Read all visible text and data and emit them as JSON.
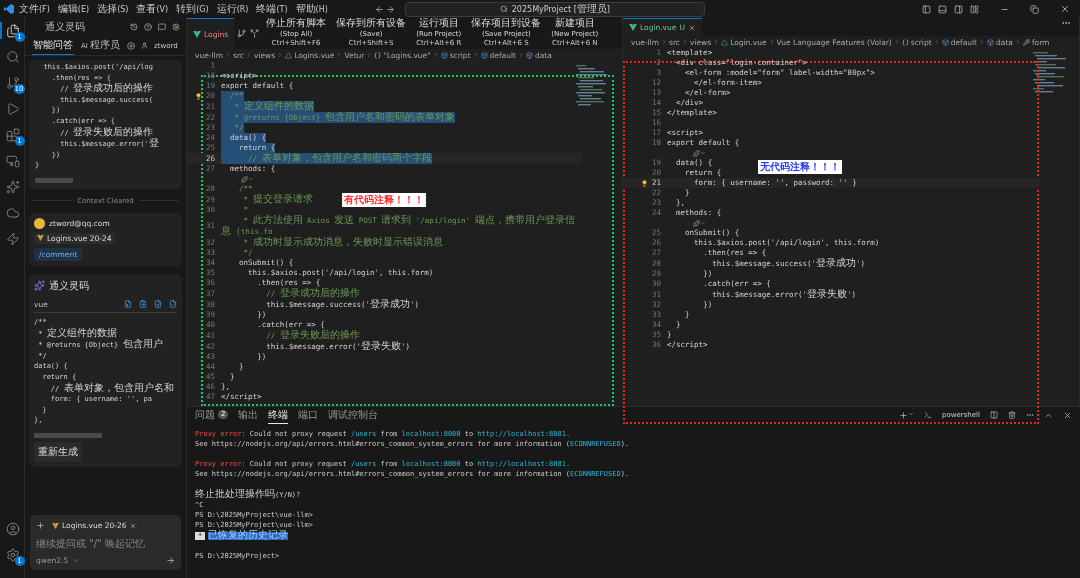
{
  "title_bar": {
    "menus": [
      "文件(F)",
      "编辑(E)",
      "选择(S)",
      "查看(V)",
      "转到(G)",
      "运行(R)",
      "终端(T)",
      "帮助(H)"
    ],
    "search": "2025MyProject [管理员]"
  },
  "activity_bar": {
    "items": [
      {
        "kind": "files",
        "badge": "1",
        "selected": true
      },
      {
        "kind": "search",
        "selected": false
      },
      {
        "kind": "git",
        "badge": "10",
        "selected": false
      },
      {
        "kind": "run",
        "selected": false
      },
      {
        "kind": "extensions",
        "badge": "1",
        "selected": false
      },
      {
        "kind": "remote",
        "selected": false
      },
      {
        "kind": "lingma",
        "selected": false
      },
      {
        "kind": "cloud",
        "selected": false
      },
      {
        "kind": "marscode",
        "selected": false
      }
    ],
    "bottom": [
      {
        "kind": "account"
      },
      {
        "kind": "settings",
        "badge": "1"
      }
    ]
  },
  "assistant": {
    "title": "通义灵码",
    "tabs": [
      {
        "label": "智能问答",
        "selected": true
      },
      {
        "label": "AI 程序员",
        "selected": false
      }
    ],
    "user": "ztword",
    "history_code": [
      "  this.$axios.post('/api/log",
      "    .then(res => {",
      "      // 登录成功后的操作",
      "      this.$message.success(",
      "    })",
      "    .catch(err => {",
      "      // 登录失败后的操作",
      "      this.$message.error('登",
      "    })",
      "}"
    ],
    "divider": "Context Cleared",
    "user_message": {
      "email": "ztword@qq.com",
      "file": "Logins.vue 20-24",
      "command": "/comment"
    },
    "reply": {
      "name": "通义灵码",
      "language": "vue",
      "code": [
        "/**",
        " * 定义组件的数据",
        " * @returns {Object} 包含用户",
        " */",
        "data() {",
        "  return {",
        "    // 表单对象，包含用户名和",
        "    form: { username: '', pa",
        "  }",
        "},"
      ],
      "regenerate": "重新生成"
    },
    "input": {
      "chip": "Logins.vue 20-26",
      "placeholder": "继续提问或 \"/\" 唤起记忆",
      "model": "qwen2.5"
    }
  },
  "command_bar": [
    {
      "label": "停止所有脚本(Stop All)",
      "shortcut": "Ctrl+Shift+F6"
    },
    {
      "label": "保存到所有设备(Save)",
      "shortcut": "Ctrl+Shift+S"
    },
    {
      "label": "运行项目(Run Project)",
      "shortcut": "Ctrl+Alt+6 R"
    },
    {
      "label": "保存项目到设备(Save Project)",
      "shortcut": "Ctrl+Alt+6 S"
    },
    {
      "label": "新建项目(New Project)",
      "shortcut": "Ctrl+Alt+6 N"
    }
  ],
  "editors": [
    {
      "tab": {
        "label": "Logins",
        "kind": "error"
      },
      "breadcrumbs": [
        {
          "text": "vue-llm"
        },
        {
          "text": "src"
        },
        {
          "text": "views"
        },
        {
          "text": "Logins.vue",
          "kind": "vue"
        },
        {
          "text": "Vetur"
        },
        {
          "text": "\"Logins.vue\"",
          "kind": "braces"
        },
        {
          "text": "script",
          "kind": "module"
        },
        {
          "text": "default",
          "kind": "module"
        },
        {
          "text": "data",
          "kind": "method"
        }
      ],
      "frame": {
        "color": "#22c55e"
      },
      "annotation": {
        "text": "有代码注释！！！",
        "color": "#ff2d2d"
      },
      "lines": [
        {
          "kind": "code",
          "n": "1",
          "selected": false
        },
        {
          "kind": "code",
          "n": "18",
          "text": "<script>",
          "selected": false
        },
        {
          "kind": "code",
          "n": "19",
          "text": "export default {",
          "selected": false
        },
        {
          "kind": "comment",
          "n": "20",
          "text": "  /**",
          "selected": true,
          "bulb": true
        },
        {
          "kind": "comment",
          "n": "21",
          "text": "   * 定义组件的数据",
          "selected": true
        },
        {
          "kind": "comment",
          "n": "22",
          "text": "   * @returns {Object} 包含用户名和密码的表单对象",
          "selected": true
        },
        {
          "kind": "comment",
          "n": "23",
          "text": "   */",
          "selected": true
        },
        {
          "kind": "code",
          "n": "24",
          "text": "  data() {",
          "selected": true
        },
        {
          "kind": "code",
          "n": "25",
          "text": "    return {",
          "selected": true
        },
        {
          "kind": "comment",
          "n": "26",
          "text": "      // 表单对象，包含用户名和密码两个字段",
          "selected": true,
          "current": true
        },
        {
          "kind": "code",
          "n": "27",
          "text": "  methods: {",
          "selected": false
        },
        {
          "kind": "codelens"
        },
        {
          "kind": "comment",
          "n": "28",
          "text": "    /**",
          "selected": false
        },
        {
          "kind": "comment",
          "n": "29",
          "text": "     * 提交登录请求",
          "selected": false
        },
        {
          "kind": "comment",
          "n": "30",
          "text": "     *",
          "selected": false
        },
        {
          "kind": "comment",
          "n": "31",
          "text": "     * 此方法使用 Axios 发送 POST 请求到 '/api/login' 端点，携带用户登录信息（this.fo",
          "selected": false
        },
        {
          "kind": "comment",
          "n": "32",
          "text": "     * 成功时显示成功消息，失败时显示错误消息",
          "selected": false
        },
        {
          "kind": "comment",
          "n": "33",
          "text": "     */",
          "selected": false
        },
        {
          "kind": "code",
          "n": "34",
          "text": "    onSubmit() {",
          "selected": false
        },
        {
          "kind": "code",
          "n": "35",
          "text": "      this.$axios.post('/api/login', this.form)",
          "selected": false
        },
        {
          "kind": "code",
          "n": "36",
          "text": "        .then(res => {",
          "selected": false
        },
        {
          "kind": "comment",
          "n": "37",
          "text": "          // 登录成功后的操作",
          "selected": false
        },
        {
          "kind": "code",
          "n": "38",
          "text": "          this.$message.success('登录成功')",
          "selected": false
        },
        {
          "kind": "code",
          "n": "39",
          "text": "        })",
          "selected": false
        },
        {
          "kind": "code",
          "n": "40",
          "text": "        .catch(err => {",
          "selected": false
        },
        {
          "kind": "comment",
          "n": "41",
          "text": "          // 登录失败后的操作",
          "selected": false
        },
        {
          "kind": "code",
          "n": "42",
          "text": "          this.$message.error('登录失败')",
          "selected": false
        },
        {
          "kind": "code",
          "n": "43",
          "text": "        })",
          "selected": false
        },
        {
          "kind": "code",
          "n": "44",
          "text": "    }",
          "selected": false
        },
        {
          "kind": "code",
          "n": "45",
          "text": "  }",
          "selected": false
        },
        {
          "kind": "code",
          "n": "46",
          "text": "},",
          "selected": false
        },
        {
          "kind": "code",
          "n": "47",
          "text": "</script>",
          "selected": false
        }
      ]
    },
    {
      "tab": {
        "label": "Login.vue",
        "kind": "untracked",
        "decoration": "U"
      },
      "breadcrumbs": [
        {
          "text": "vue-llm"
        },
        {
          "text": "src"
        },
        {
          "text": "views"
        },
        {
          "text": "Login.vue",
          "kind": "vue"
        },
        {
          "text": "Vue Language Features (Volar)"
        },
        {
          "text": "script",
          "kind": "braces"
        },
        {
          "text": "default",
          "kind": "module"
        },
        {
          "text": "data",
          "kind": "method"
        },
        {
          "text": "form",
          "kind": "field"
        }
      ],
      "frame": {
        "color": "#e02424"
      },
      "annotation": {
        "text": "无代码注释！！！",
        "color": "#2b3cff"
      },
      "lines": [
        {
          "kind": "code",
          "n": "1",
          "text": "<template>",
          "selected": false
        },
        {
          "kind": "code",
          "n": "2",
          "text": "  <div class=\"login-container\">",
          "selected": false
        },
        {
          "kind": "code",
          "n": "3",
          "text": "    <el-form :model=\"form\" label-width=\"80px\">",
          "selected": false
        },
        {
          "kind": "code",
          "n": "12",
          "text": "      </el-form-item>",
          "selected": false
        },
        {
          "kind": "code",
          "n": "13",
          "text": "    </el-form>",
          "selected": false
        },
        {
          "kind": "code",
          "n": "14",
          "text": "  </div>",
          "selected": false
        },
        {
          "kind": "code",
          "n": "15",
          "text": "</template>",
          "selected": false
        },
        {
          "kind": "code",
          "n": "16",
          "selected": false
        },
        {
          "kind": "code",
          "n": "17",
          "text": "<script>",
          "selected": false
        },
        {
          "kind": "code",
          "n": "18",
          "text": "export default {",
          "selected": false
        },
        {
          "kind": "codelens"
        },
        {
          "kind": "code",
          "n": "19",
          "text": "  data() {",
          "selected": false
        },
        {
          "kind": "code",
          "n": "20",
          "text": "    return {",
          "selected": false
        },
        {
          "kind": "code",
          "n": "21",
          "text": "      form: { username: '', password: '' }",
          "selected": false,
          "bulb": true,
          "current": true
        },
        {
          "kind": "code",
          "n": "22",
          "text": "    }",
          "selected": false
        },
        {
          "kind": "code",
          "n": "23",
          "text": "  },",
          "selected": false
        },
        {
          "kind": "code",
          "n": "24",
          "text": "  methods: {",
          "selected": false
        },
        {
          "kind": "codelens"
        },
        {
          "kind": "code",
          "n": "25",
          "text": "    onSubmit() {",
          "selected": false
        },
        {
          "kind": "code",
          "n": "26",
          "text": "      this.$axios.post('/api/login', this.form)",
          "selected": false
        },
        {
          "kind": "code",
          "n": "27",
          "text": "        .then(res => {",
          "selected": false
        },
        {
          "kind": "code",
          "n": "28",
          "text": "          this.$message.success('登录成功')",
          "selected": false
        },
        {
          "kind": "code",
          "n": "29",
          "text": "        })",
          "selected": false
        },
        {
          "kind": "code",
          "n": "30",
          "text": "        .catch(err => {",
          "selected": false
        },
        {
          "kind": "code",
          "n": "31",
          "text": "          this.$message.error('登录失败')",
          "selected": false
        },
        {
          "kind": "code",
          "n": "32",
          "text": "        })",
          "selected": false
        },
        {
          "kind": "code",
          "n": "33",
          "text": "    }",
          "selected": false
        },
        {
          "kind": "code",
          "n": "34",
          "text": "  }",
          "selected": false
        },
        {
          "kind": "code",
          "n": "35",
          "text": "}",
          "selected": false
        },
        {
          "kind": "code",
          "n": "36",
          "text": "</script>",
          "selected": false
        }
      ]
    }
  ],
  "panel": {
    "tabs": [
      {
        "label": "问题",
        "count": "2",
        "selected": false
      },
      {
        "label": "输出",
        "selected": false
      },
      {
        "label": "终端",
        "selected": true
      },
      {
        "label": "端口",
        "selected": false
      },
      {
        "label": "调试控制台",
        "selected": false
      }
    ],
    "shell": "powershell",
    "lines": [
      {
        "parts": [
          {
            "text": "Proxy error:",
            "kind": "error"
          },
          {
            "text": " Could not proxy request ",
            "kind": "plain"
          },
          {
            "text": "/users",
            "kind": "link"
          },
          {
            "text": " from ",
            "kind": "plain"
          },
          {
            "text": "localhost:8080",
            "kind": "link"
          },
          {
            "text": " to ",
            "kind": "plain"
          },
          {
            "text": "http://localhost:8081.",
            "kind": "link"
          }
        ]
      },
      {
        "parts": [
          {
            "text": "See https://nodejs.org/api/errors.html#errors_common_system_errors for more information (",
            "kind": "plain"
          },
          {
            "text": "ECONNREFUSED",
            "kind": "link"
          },
          {
            "text": ").",
            "kind": "plain"
          }
        ]
      },
      {
        "spaced": true,
        "parts": [
          {
            "text": "Proxy error:",
            "kind": "error"
          },
          {
            "text": " Could not proxy request ",
            "kind": "plain"
          },
          {
            "text": "/users",
            "kind": "link"
          },
          {
            "text": " from ",
            "kind": "plain"
          },
          {
            "text": "localhost:8080",
            "kind": "link"
          },
          {
            "text": " to ",
            "kind": "plain"
          },
          {
            "text": "http://localhost:8081.",
            "kind": "link"
          }
        ]
      },
      {
        "parts": [
          {
            "text": "See https://nodejs.org/api/errors.html#errors_common_system_errors for more information (",
            "kind": "plain"
          },
          {
            "text": "ECONNREFUSED",
            "kind": "link"
          },
          {
            "text": ").",
            "kind": "plain"
          }
        ]
      },
      {
        "spaced": true,
        "parts": [
          {
            "text": "终止批处理操作吗(Y/N)?",
            "kind": "plain"
          }
        ]
      },
      {
        "parts": [
          {
            "text": "^C",
            "kind": "plain"
          }
        ]
      },
      {
        "parts": [
          {
            "text": "PS D:\\2025MyProject\\vue-llm>",
            "kind": "plain"
          }
        ]
      },
      {
        "parts": [
          {
            "text": "PS D:\\2025MyProject\\vue-llm>",
            "kind": "plain"
          }
        ]
      },
      {
        "parts": [
          {
            "text": "*",
            "kind": "badge"
          },
          {
            "text": "已恢复的历史记录",
            "kind": "highlight"
          }
        ]
      },
      {
        "spaced": true,
        "parts": [
          {
            "text": "PS D:\\2025MyProject>",
            "kind": "plain"
          }
        ]
      }
    ]
  }
}
